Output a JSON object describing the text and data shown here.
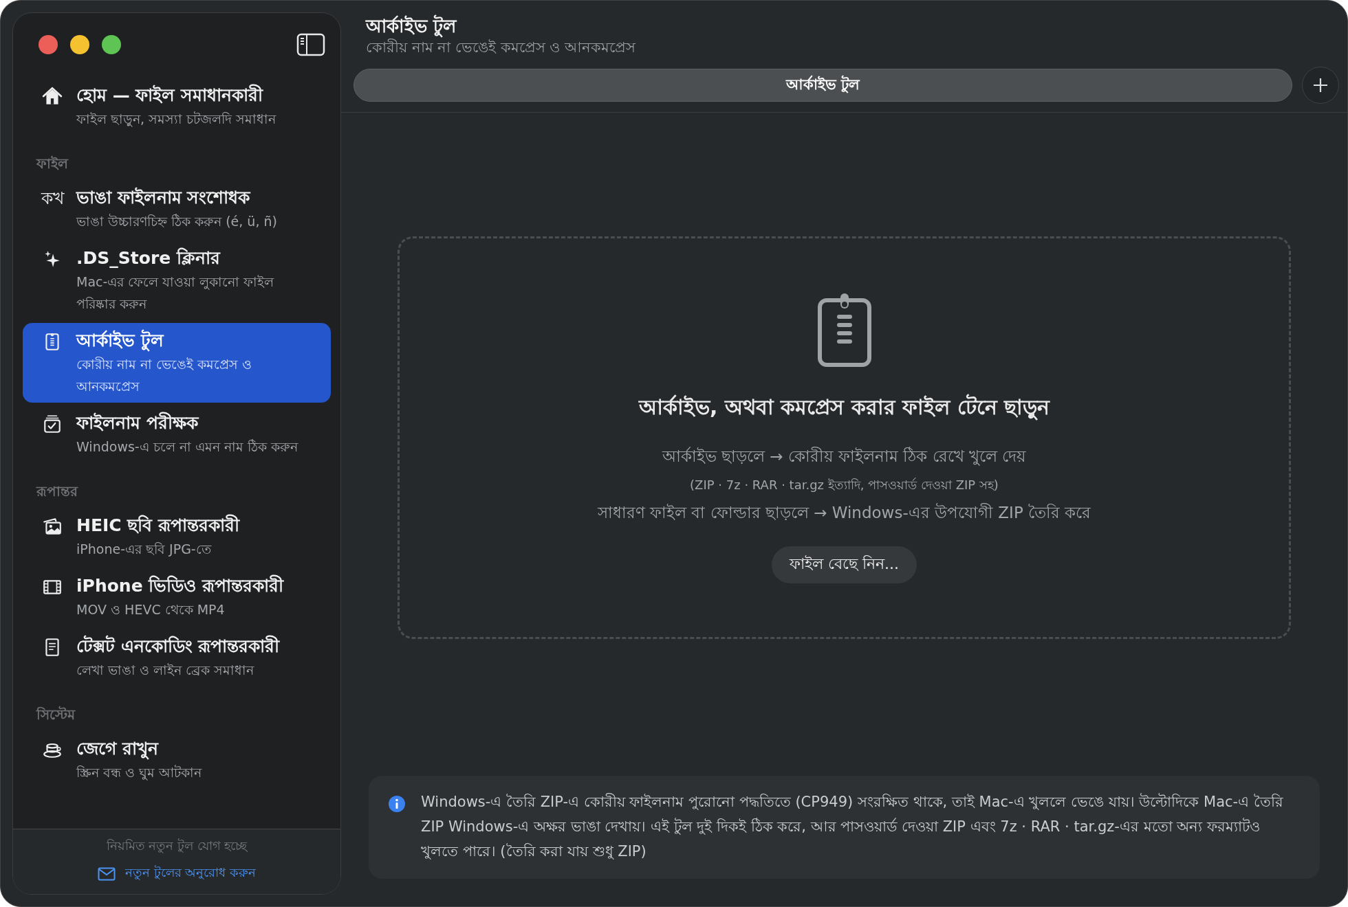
{
  "sidebar": {
    "home": {
      "title": "হোম — ফাইল সমাধানকারী",
      "subtitle": "ফাইল ছাড়ুন, সমস্যা চটজলদি সমাধান",
      "selected": false
    },
    "sections": [
      {
        "title": "ফাইল",
        "items": [
          {
            "icon_text": "কখ",
            "title": "ভাঙা ফাইলনাম সংশোধক",
            "subtitle": "ভাঙা উচ্চারণচিহ্ন ঠিক করুন (é, ü, ñ)",
            "selected": false
          },
          {
            "title": ".DS_Store ক্লিনার",
            "subtitle": "Mac-এর ফেলে যাওয়া লুকানো ফাইল পরিষ্কার করুন",
            "selected": false
          },
          {
            "title": "আর্কাইভ টুল",
            "subtitle": "কোরীয় নাম না ভেঙেই কমপ্রেস ও আনকমপ্রেস",
            "selected": true
          },
          {
            "title": "ফাইলনাম পরীক্ষক",
            "subtitle": "Windows-এ চলে না এমন নাম ঠিক করুন",
            "selected": false
          }
        ]
      },
      {
        "title": "রূপান্তর",
        "items": [
          {
            "title": "HEIC ছবি রূপান্তরকারী",
            "subtitle": "iPhone-এর ছবি JPG-তে",
            "selected": false
          },
          {
            "title": "iPhone ভিডিও রূপান্তরকারী",
            "subtitle": "MOV ও HEVC থেকে MP4",
            "selected": false
          },
          {
            "title": "টেক্সট এনকোডিং রূপান্তরকারী",
            "subtitle": "লেখা ভাঙা ও লাইন ব্রেক সমাধান",
            "selected": false
          }
        ]
      },
      {
        "title": "সিস্টেম",
        "items": [
          {
            "title": "জেগে রাখুন",
            "subtitle": "স্ক্রিন বন্ধ ও ঘুম আটকান",
            "selected": false
          }
        ]
      }
    ],
    "footer": {
      "note": "নিয়মিত নতুন টুল যোগ হচ্ছে",
      "link": "নতুন টুলের অনুরোধ করুন"
    }
  },
  "header": {
    "title": "আর্কাইভ টুল",
    "subtitle": "কোরীয় নাম না ভেঙেই কমপ্রেস ও আনকমপ্রেস"
  },
  "tabs": [
    {
      "label": "আর্কাইভ টুল",
      "selected": true
    }
  ],
  "dropzone": {
    "heading": "আর্কাইভ, অথবা কমপ্রেস করার ফাইল টেনে ছাড়ুন",
    "lines": [
      {
        "kind": "main",
        "text": "আর্কাইভ ছাড়লে → কোরীয় ফাইলনাম ঠিক রেখে খুলে দেয়"
      },
      {
        "kind": "note",
        "text": "(ZIP · 7z · RAR · tar.gz ইত্যাদি, পাসওয়ার্ড দেওয়া ZIP সহ)"
      },
      {
        "kind": "main",
        "text": "সাধারণ ফাইল বা ফোল্ডার ছাড়লে → Windows-এর উপযোগী ZIP তৈরি করে"
      }
    ],
    "button": "ফাইল বেছে নিন..."
  },
  "info": {
    "text": "Windows-এ তৈরি ZIP-এ কোরীয় ফাইলনাম পুরোনো পদ্ধতিতে (CP949) সংরক্ষিত থাকে, তাই Mac-এ খুললে ভেঙে যায়। উল্টোদিকে Mac-এ তৈরি ZIP Windows-এ অক্ষর ভাঙা দেখায়। এই টুল দুই দিকই ঠিক করে, আর পাসওয়ার্ড দেওয়া ZIP এবং 7z · RAR · tar.gz-এর মতো অন্য ফরম্যাটও খুলতে পারে। (তৈরি করা যায় শুধু ZIP)"
  }
}
